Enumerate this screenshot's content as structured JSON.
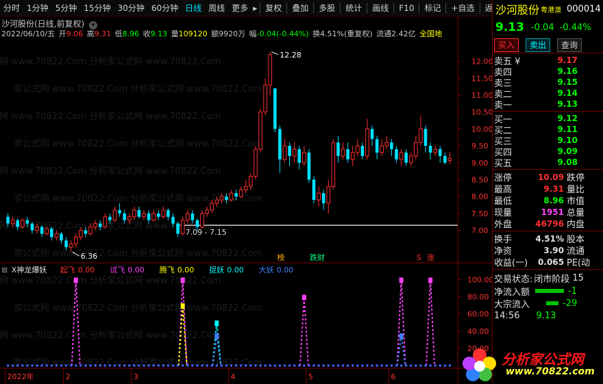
{
  "toolbar": {
    "periods": [
      "分时",
      "1分钟",
      "5分钟",
      "15分钟",
      "30分钟",
      "60分钟",
      "日线",
      "周线",
      "更多"
    ],
    "active_period": "日线",
    "more_arrow": "▸",
    "tools": [
      "复权",
      "叠加",
      "多股",
      "统计",
      "画线",
      "F10",
      "标记",
      "+自选",
      "返回"
    ]
  },
  "chart_header": {
    "title": "沙河股份(日线,前复权)",
    "date": "2022/06/10/五",
    "open_label": "开",
    "open": "9.06",
    "high_label": "高",
    "high": "9.31",
    "low_label": "低",
    "low": "8.96",
    "close_label": "收",
    "close": "9.13",
    "vol_label": "量",
    "volume": "109120",
    "amount_label": "额",
    "amount": "9920万",
    "change_label": "幅",
    "change": "-0.04(-0.44%)",
    "turnover_label": "换",
    "turnover": "4.51%(重复权)",
    "float_label": "流通",
    "float_cap": "2.42亿",
    "region": "全国地"
  },
  "chart_annotations": {
    "high_price": "12.28",
    "low_price": "6.36",
    "range": "7.09 - 7.15",
    "tag_bang": "榜",
    "tag_caifu": "跌财",
    "tag_zhang": "涨",
    "tag_s": "S"
  },
  "chart_data": {
    "type": "candlestick",
    "ylim": [
      6.2,
      12.6
    ],
    "yticks": [
      "12.00",
      "11.50",
      "11.00",
      "10.50",
      "10.00",
      "9.50",
      "9.00",
      "8.50",
      "8.00",
      "7.50",
      "7.00"
    ],
    "ytick_values": [
      12.0,
      11.5,
      11.0,
      10.5,
      10.0,
      9.5,
      9.0,
      8.5,
      8.0,
      7.5,
      7.0
    ],
    "reference_line": 7.15,
    "candles": [
      [
        7.4,
        7.2,
        7.5,
        7.1
      ],
      [
        7.2,
        7.3,
        7.4,
        7.1
      ],
      [
        7.3,
        7.1,
        7.35,
        7.0
      ],
      [
        7.1,
        7.3,
        7.35,
        7.05
      ],
      [
        7.3,
        7.2,
        7.4,
        7.1
      ],
      [
        7.2,
        7.0,
        7.25,
        6.9
      ],
      [
        7.0,
        7.1,
        7.2,
        6.9
      ],
      [
        7.1,
        6.9,
        7.15,
        6.8
      ],
      [
        6.9,
        7.05,
        7.1,
        6.85
      ],
      [
        7.05,
        6.8,
        7.1,
        6.7
      ],
      [
        6.8,
        6.9,
        7.0,
        6.7
      ],
      [
        6.9,
        6.7,
        6.95,
        6.6
      ],
      [
        6.7,
        6.5,
        6.8,
        6.4
      ],
      [
        6.5,
        6.6,
        6.7,
        6.36
      ],
      [
        6.6,
        6.8,
        6.9,
        6.5
      ],
      [
        6.8,
        7.0,
        7.1,
        6.7
      ],
      [
        7.0,
        6.9,
        7.1,
        6.8
      ],
      [
        6.9,
        7.1,
        7.2,
        6.85
      ],
      [
        7.1,
        7.2,
        7.3,
        7.0
      ],
      [
        7.2,
        7.1,
        7.3,
        7.0
      ],
      [
        7.1,
        7.4,
        7.5,
        7.05
      ],
      [
        7.4,
        7.3,
        7.5,
        7.2
      ],
      [
        7.3,
        7.6,
        7.7,
        7.25
      ],
      [
        7.6,
        7.5,
        7.8,
        7.4
      ],
      [
        7.5,
        7.3,
        7.6,
        7.2
      ],
      [
        7.3,
        7.4,
        7.5,
        7.2
      ],
      [
        7.4,
        7.6,
        7.7,
        7.3
      ],
      [
        7.6,
        7.4,
        7.7,
        7.35
      ],
      [
        7.4,
        7.5,
        7.6,
        7.3
      ],
      [
        7.5,
        7.3,
        7.6,
        7.2
      ],
      [
        7.3,
        7.5,
        7.6,
        7.25
      ],
      [
        7.5,
        7.4,
        7.6,
        7.3
      ],
      [
        7.4,
        7.6,
        7.7,
        7.35
      ],
      [
        7.6,
        7.4,
        7.65,
        7.3
      ],
      [
        7.4,
        7.2,
        7.5,
        7.1
      ],
      [
        7.2,
        6.9,
        7.25,
        6.8
      ],
      [
        6.9,
        7.3,
        7.4,
        6.85
      ],
      [
        7.3,
        7.5,
        7.6,
        7.2
      ],
      [
        7.5,
        7.3,
        7.6,
        7.2
      ],
      [
        7.3,
        7.1,
        7.35,
        7.0
      ],
      [
        7.1,
        7.5,
        7.6,
        7.05
      ],
      [
        7.5,
        7.6,
        7.7,
        7.4
      ],
      [
        7.6,
        7.8,
        7.9,
        7.5
      ],
      [
        7.8,
        7.9,
        8.0,
        7.7
      ],
      [
        7.9,
        8.0,
        8.1,
        7.8
      ],
      [
        8.0,
        7.9,
        8.1,
        7.8
      ],
      [
        7.9,
        8.1,
        8.2,
        7.85
      ],
      [
        8.1,
        8.0,
        8.2,
        7.9
      ],
      [
        8.0,
        8.2,
        8.3,
        7.95
      ],
      [
        8.2,
        8.3,
        8.5,
        8.1
      ],
      [
        8.3,
        8.6,
        8.7,
        8.2
      ],
      [
        8.6,
        9.4,
        9.5,
        8.5
      ],
      [
        9.4,
        10.5,
        10.6,
        9.3
      ],
      [
        10.5,
        11.3,
        11.5,
        10.4
      ],
      [
        11.3,
        12.2,
        12.28,
        11.0
      ],
      [
        11.2,
        10.0,
        11.2,
        9.9
      ],
      [
        10.0,
        9.1,
        10.1,
        8.7
      ],
      [
        9.1,
        9.5,
        9.7,
        9.0
      ],
      [
        9.5,
        9.2,
        9.6,
        8.9
      ],
      [
        9.2,
        9.4,
        9.6,
        9.0
      ],
      [
        9.4,
        9.0,
        9.5,
        8.8
      ],
      [
        9.0,
        9.3,
        9.5,
        8.9
      ],
      [
        9.3,
        8.5,
        9.4,
        8.4
      ],
      [
        8.5,
        7.9,
        8.6,
        7.8
      ],
      [
        7.9,
        8.1,
        8.3,
        7.7
      ],
      [
        8.1,
        7.8,
        8.2,
        7.6
      ],
      [
        7.8,
        8.3,
        8.5,
        7.5
      ],
      [
        8.3,
        9.6,
        9.7,
        8.2
      ],
      [
        9.6,
        9.2,
        9.8,
        9.0
      ],
      [
        9.2,
        9.4,
        9.6,
        9.1
      ],
      [
        9.4,
        9.1,
        9.6,
        9.0
      ],
      [
        9.1,
        9.3,
        9.5,
        8.9
      ],
      [
        9.3,
        9.5,
        9.7,
        9.2
      ],
      [
        9.5,
        9.2,
        9.6,
        9.1
      ],
      [
        9.2,
        10.0,
        10.3,
        9.1
      ],
      [
        10.0,
        9.7,
        10.1,
        9.5
      ],
      [
        9.7,
        9.3,
        9.8,
        9.1
      ],
      [
        9.3,
        9.5,
        9.7,
        9.2
      ],
      [
        9.5,
        9.6,
        9.8,
        9.4
      ],
      [
        9.6,
        9.4,
        9.7,
        9.2
      ],
      [
        9.4,
        9.1,
        9.5,
        9.0
      ],
      [
        9.1,
        9.3,
        9.4,
        8.9
      ],
      [
        9.3,
        9.0,
        9.4,
        8.9
      ],
      [
        9.0,
        9.2,
        9.3,
        8.9
      ],
      [
        9.2,
        9.6,
        9.8,
        9.1
      ],
      [
        9.6,
        10.0,
        10.4,
        9.5
      ],
      [
        10.0,
        9.5,
        10.1,
        9.3
      ],
      [
        9.5,
        9.3,
        9.6,
        9.1
      ],
      [
        9.3,
        9.4,
        9.5,
        9.2
      ],
      [
        9.4,
        9.2,
        9.5,
        9.0
      ],
      [
        9.2,
        9.0,
        9.3,
        8.96
      ],
      [
        9.06,
        9.13,
        9.31,
        8.96
      ]
    ],
    "indicator": {
      "name": "X神龙爆妖",
      "fields": [
        {
          "label": "起飞",
          "value": "0.00",
          "color": "#ff3030"
        },
        {
          "label": "试飞",
          "value": "0.00",
          "color": "#ff40ff"
        },
        {
          "label": "腾飞",
          "value": "0.00",
          "color": "#ffff00"
        },
        {
          "label": "捉妖",
          "value": "0.00",
          "color": "#00ffff"
        },
        {
          "label": "大妖",
          "value": "0.00",
          "color": "#4080ff"
        }
      ],
      "ylim": [
        0,
        110
      ],
      "yticks": [
        "100.00",
        "80.00",
        "60.00",
        "40.00",
        "20.00"
      ],
      "ytick_values": [
        100,
        80,
        60,
        40,
        20
      ],
      "spikes": [
        {
          "index": 14,
          "value": 100,
          "color": "#ff40ff"
        },
        {
          "index": 36,
          "value": 100,
          "color": "#ff40ff"
        },
        {
          "index": 36,
          "value": 70,
          "color": "#ffff00"
        },
        {
          "index": 43,
          "value": 50,
          "color": "#00ffff"
        },
        {
          "index": 43,
          "value": 35,
          "color": "#4080ff"
        },
        {
          "index": 61,
          "value": 80,
          "color": "#ff40ff"
        },
        {
          "index": 81,
          "value": 100,
          "color": "#ff40ff"
        },
        {
          "index": 81,
          "value": 35,
          "color": "#4080ff"
        },
        {
          "index": 87,
          "value": 100,
          "color": "#ff40ff"
        }
      ]
    },
    "x_labels": [
      {
        "label": "2022年",
        "index": 0
      },
      {
        "label": "2",
        "index": 12
      },
      {
        "label": "3",
        "index": 26
      },
      {
        "label": "4",
        "index": 46
      },
      {
        "label": "5",
        "index": 62
      },
      {
        "label": "6",
        "index": 79
      }
    ]
  },
  "quote_panel": {
    "name": "沙河股份",
    "badge": "粤港澳",
    "code": "000014",
    "price": "9.13",
    "change": "-0.04",
    "change_pct": "-0.44%",
    "buy_btn": "买入",
    "sell_btn": "卖出",
    "query_btn": "查询",
    "asks": [
      {
        "label": "卖五 ¥",
        "price": "9.17",
        "color": "#ff3030"
      },
      {
        "label": "卖四",
        "price": "9.16",
        "color": "#00ff00"
      },
      {
        "label": "卖三",
        "price": "9.15",
        "color": "#00ff00"
      },
      {
        "label": "卖二",
        "price": "9.14",
        "color": "#00ff00"
      },
      {
        "label": "卖一",
        "price": "9.13",
        "color": "#00ff00"
      }
    ],
    "bids": [
      {
        "label": "买一",
        "price": "9.12",
        "color": "#00ff00"
      },
      {
        "label": "买二",
        "price": "9.11",
        "color": "#00ff00"
      },
      {
        "label": "买三",
        "price": "9.10",
        "color": "#00ff00"
      },
      {
        "label": "买四",
        "price": "9.09",
        "color": "#00ff00"
      },
      {
        "label": "买五",
        "price": "9.08",
        "color": "#00ff00"
      }
    ],
    "stats": [
      {
        "label": "涨停",
        "value": "10.09",
        "color": "#ff3030",
        "label2": "跌停"
      },
      {
        "label": "最高",
        "value": "9.31",
        "color": "#ff3030",
        "label2": "量比"
      },
      {
        "label": "最低",
        "value": "8.96",
        "color": "#00ff00",
        "label2": "市值"
      },
      {
        "label": "现量",
        "value": "1951",
        "color": "#ff40ff",
        "label2": "总量"
      },
      {
        "label": "外盘",
        "value": "46796",
        "color": "#ff3030",
        "label2": "内盘"
      }
    ],
    "stats2": [
      {
        "label": "换手",
        "value": "4.51%",
        "color": "#e0e0e0",
        "label2": "股本"
      },
      {
        "label": "净资",
        "value": "3.90",
        "color": "#e0e0e0",
        "label2": "流通"
      },
      {
        "label": "收益(一)",
        "value": "0.065",
        "color": "#e0e0e0",
        "label2": "PE(动"
      }
    ],
    "trade_status_label": "交易状态:",
    "trade_status": "闭市阶段",
    "trade_status_num": "15",
    "net_inflow_label": "净流入额",
    "net_inflow_value": "-1",
    "block_label": "大宗流入",
    "block_value": "-29",
    "time_label": "14:56",
    "time_price": "9.13"
  },
  "watermark": {
    "text": "分析家公式网",
    "url": "www.70822.com",
    "tile": "家公式网 www.70822.Com 分析家公式网 www.70822.Com"
  },
  "colors": {
    "up": "#ff3030",
    "down": "#00e0ff",
    "axis": "#7a0000"
  }
}
